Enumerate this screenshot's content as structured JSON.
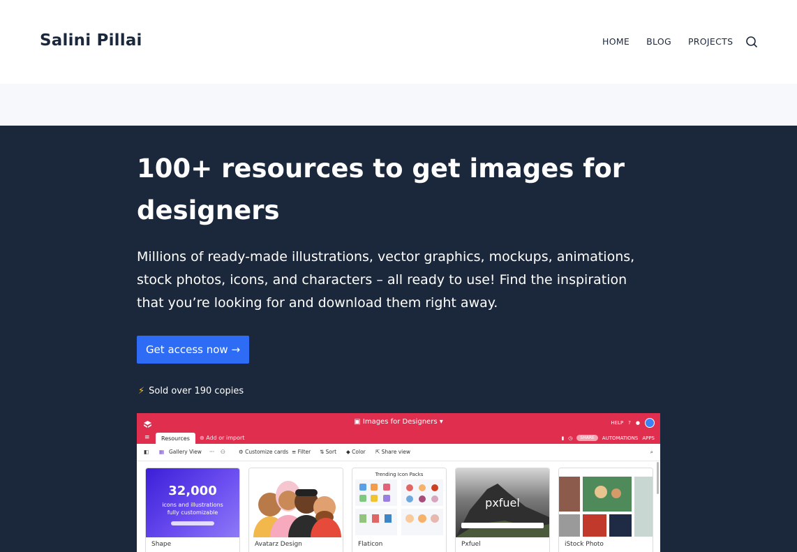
{
  "header": {
    "site_title": "Salini Pillai",
    "nav": [
      "HOME",
      "BLOG",
      "PROJECTS"
    ],
    "search_icon": "search-icon"
  },
  "hero": {
    "title": "100+ resources to get images for designers",
    "description": "Millions of ready-made illustrations, vector graphics, mockups, animations, stock photos, icons, and characters – all ready to use! Find the inspiration that you’re looking for and download them right away.",
    "cta_label": "Get access now →",
    "sold_text": "Sold over 190 copies",
    "sold_icon": "⚡"
  },
  "app": {
    "title": "Images for Designers",
    "top_right": [
      "HELP"
    ],
    "tab_active": "Resources",
    "tab_add": "Add or import",
    "share": "SHARE",
    "automations": "AUTOMATIONS",
    "apps": "APPS",
    "view_name": "Gallery View",
    "toolbar": [
      "Customize cards",
      "Filter",
      "Sort",
      "Color",
      "Share view"
    ],
    "cards": [
      {
        "label": "Shape",
        "big": "32,000",
        "sub": "icons and illustrations fully customizable"
      },
      {
        "label": "Avatarz Design"
      },
      {
        "label": "Flaticon",
        "heading": "Trending Icon Packs"
      },
      {
        "label": "Pxfuel",
        "brand": "pxfuel"
      },
      {
        "label": "iStock Photo"
      }
    ]
  },
  "colors": {
    "header_bg": "#ffffff",
    "hero_bg": "#1b283b",
    "cta": "#2f6cf6",
    "app_bar": "#e02e4f"
  }
}
